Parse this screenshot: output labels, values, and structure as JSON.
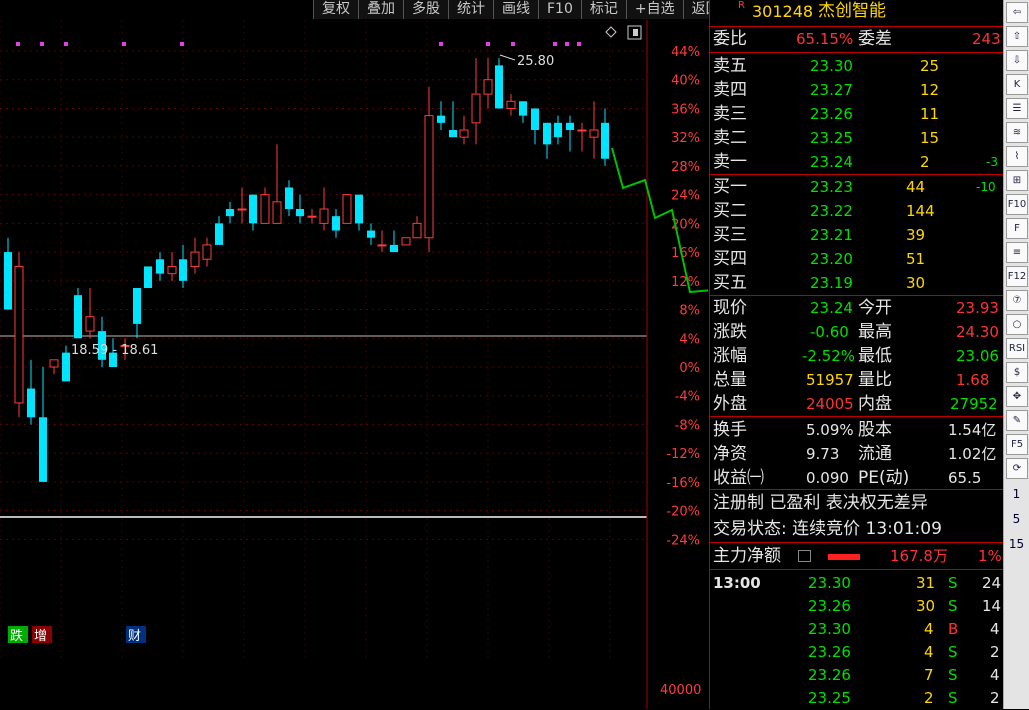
{
  "toolbar": [
    "复权",
    "叠加",
    "多股",
    "统计",
    "画线",
    "F10",
    "标记",
    "+自选",
    "返回"
  ],
  "stock": {
    "badge": "R",
    "code": "301248",
    "name": "杰创智能"
  },
  "weibi": {
    "label1": "委比",
    "value1": "65.15%",
    "label2": "委差",
    "value2": "243"
  },
  "asks": [
    {
      "label": "卖五",
      "price": "23.30",
      "vol": "25",
      "chg": ""
    },
    {
      "label": "卖四",
      "price": "23.27",
      "vol": "12",
      "chg": ""
    },
    {
      "label": "卖三",
      "price": "23.26",
      "vol": "11",
      "chg": ""
    },
    {
      "label": "卖二",
      "price": "23.25",
      "vol": "15",
      "chg": ""
    },
    {
      "label": "卖一",
      "price": "23.24",
      "vol": "2",
      "chg": "-3"
    }
  ],
  "bids": [
    {
      "label": "买一",
      "price": "23.23",
      "vol": "44",
      "chg": "-10"
    },
    {
      "label": "买二",
      "price": "23.22",
      "vol": "144",
      "chg": ""
    },
    {
      "label": "买三",
      "price": "23.21",
      "vol": "39",
      "chg": ""
    },
    {
      "label": "买四",
      "price": "23.20",
      "vol": "51",
      "chg": ""
    },
    {
      "label": "买五",
      "price": "23.19",
      "vol": "30",
      "chg": ""
    }
  ],
  "quote": [
    {
      "l1": "现价",
      "v1": "23.24",
      "l2": "今开",
      "v2": "23.93"
    },
    {
      "l1": "涨跌",
      "v1": "-0.60",
      "l2": "最高",
      "v2": "24.30"
    },
    {
      "l1": "涨幅",
      "v1": "-2.52%",
      "l2": "最低",
      "v2": "23.06"
    },
    {
      "l1": "总量",
      "v1": "51957",
      "l2": "量比",
      "v2": "1.68"
    },
    {
      "l1": "外盘",
      "v1": "24005",
      "l2": "内盘",
      "v2": "27952"
    }
  ],
  "fund": [
    {
      "l1": "换手",
      "v1": "5.09%",
      "l2": "股本",
      "v2": "1.54亿"
    },
    {
      "l1": "净资",
      "v1": "9.73",
      "l2": "流通",
      "v2": "1.02亿"
    },
    {
      "l1": "收益㈠",
      "v1": "0.090",
      "l2": "PE(动)",
      "v2": "65.5"
    }
  ],
  "info": {
    "reg": "注册制 已盈利 表决权无差异",
    "status": "交易状态: 连续竞价 13:01:09"
  },
  "mainflow": {
    "label": "主力净额",
    "value": "167.8万",
    "pct": "1%"
  },
  "ticks": [
    {
      "time": "13:00",
      "price": "23.30",
      "vol": "31",
      "side": "S",
      "n": "24"
    },
    {
      "time": "",
      "price": "23.26",
      "vol": "30",
      "side": "S",
      "n": "14"
    },
    {
      "time": "",
      "price": "23.30",
      "vol": "4",
      "side": "B",
      "n": "4"
    },
    {
      "time": "",
      "price": "23.26",
      "vol": "4",
      "side": "S",
      "n": "2"
    },
    {
      "time": "",
      "price": "23.26",
      "vol": "7",
      "side": "S",
      "n": "4"
    },
    {
      "time": "",
      "price": "23.25",
      "vol": "2",
      "side": "S",
      "n": "2"
    }
  ],
  "chart_data": {
    "type": "candlestick",
    "y_axis_percent": [
      "44%",
      "40%",
      "36%",
      "32%",
      "28%",
      "24%",
      "20%",
      "16%",
      "12%",
      "8%",
      "4%",
      "0%",
      "-4%",
      "-8%",
      "-12%",
      "-16%",
      "-20%",
      "-24%"
    ],
    "volume_label": "40000",
    "max_label": "25.80",
    "range_label": "18.59 - 18.61",
    "markers": [
      "跌",
      "增",
      "财"
    ],
    "colors": {
      "up": "#ff3c3c",
      "down": "#00e5ff",
      "grid": "#8b0000",
      "line": "#00c000"
    }
  },
  "sidebar": [
    "⇦",
    "⇧",
    "⇩",
    "K",
    "☰",
    "≋",
    "⌇",
    "⊞",
    "F10",
    "F",
    "≡",
    "F12",
    "⑦",
    "○",
    "RSI",
    "$",
    "✥",
    "✎",
    "F5",
    "⟳",
    "1",
    "5",
    "15"
  ]
}
